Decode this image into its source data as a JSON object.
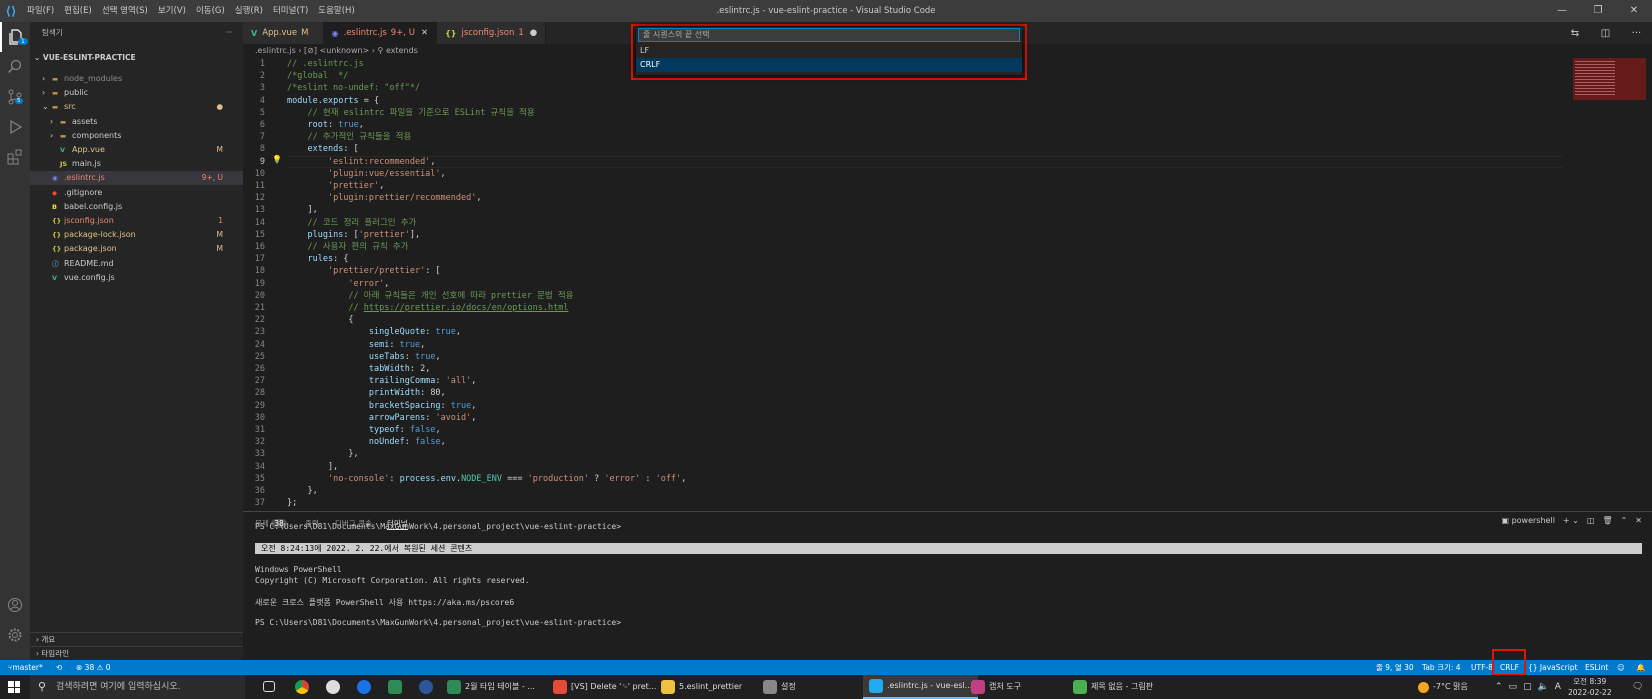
{
  "window": {
    "title": ".eslintrc.js - vue-eslint-practice - Visual Studio Code",
    "menus": [
      "파일(F)",
      "편집(E)",
      "선택 영역(S)",
      "보기(V)",
      "이동(G)",
      "실행(R)",
      "터미널(T)",
      "도움말(H)"
    ],
    "controls": [
      "—",
      "❐",
      "✕"
    ]
  },
  "activity": {
    "badge": "1"
  },
  "sidebar": {
    "header": "탐색기",
    "header_more": "···",
    "project": "VUE-ESLINT-PRACTICE",
    "items": [
      {
        "label": "node_modules",
        "status": "",
        "kind": "folder",
        "depth": 1,
        "arrow": "›",
        "color": "#8c8c8c"
      },
      {
        "label": "public",
        "status": "",
        "kind": "folder",
        "depth": 1,
        "arrow": "›",
        "color": "#cccccc"
      },
      {
        "label": "src",
        "status": "●",
        "kind": "folder",
        "depth": 1,
        "arrow": "⌄",
        "color": "#e2c08d"
      },
      {
        "label": "assets",
        "status": "",
        "kind": "folder",
        "depth": 2,
        "arrow": "›",
        "color": "#cccccc"
      },
      {
        "label": "components",
        "status": "",
        "kind": "folder",
        "depth": 2,
        "arrow": "›",
        "color": "#cccccc"
      },
      {
        "label": "App.vue",
        "status": "M",
        "kind": "vue",
        "depth": 2,
        "arrow": "",
        "color": "#e2c08d"
      },
      {
        "label": "main.js",
        "status": "",
        "kind": "js",
        "depth": 2,
        "arrow": "",
        "color": "#cccccc"
      },
      {
        "label": ".eslintrc.js",
        "status": "9+, U",
        "kind": "eslint",
        "depth": 1,
        "arrow": "",
        "color": "#f48771"
      },
      {
        "label": ".gitignore",
        "status": "",
        "kind": "git",
        "depth": 1,
        "arrow": "",
        "color": "#cccccc"
      },
      {
        "label": "babel.config.js",
        "status": "",
        "kind": "babel",
        "depth": 1,
        "arrow": "",
        "color": "#cccccc"
      },
      {
        "label": "jsconfig.json",
        "status": "1",
        "kind": "json",
        "depth": 1,
        "arrow": "",
        "color": "#f48771"
      },
      {
        "label": "package-lock.json",
        "status": "M",
        "kind": "json",
        "depth": 1,
        "arrow": "",
        "color": "#e2c08d"
      },
      {
        "label": "package.json",
        "status": "M",
        "kind": "json",
        "depth": 1,
        "arrow": "",
        "color": "#e2c08d"
      },
      {
        "label": "README.md",
        "status": "",
        "kind": "md",
        "depth": 1,
        "arrow": "",
        "color": "#cccccc"
      },
      {
        "label": "vue.config.js",
        "status": "",
        "kind": "vuejs",
        "depth": 1,
        "arrow": "",
        "color": "#cccccc"
      }
    ],
    "outline": "개요",
    "timeline": "타임라인"
  },
  "tabs": [
    {
      "label": "App.vue",
      "status": "M",
      "color": "#e2c08d",
      "icon": "V",
      "icon_color": "#41b883"
    },
    {
      "label": ".eslintrc.js",
      "status": "9+, U",
      "color": "#f48771",
      "icon": "◉",
      "icon_color": "#8080f2"
    },
    {
      "label": "jsconfig.json",
      "status": "1",
      "color": "#f48771",
      "icon": "{}",
      "icon_color": "#cbcb41"
    }
  ],
  "breadcrumb": ".eslintrc.js  ›  [⊘] <unknown>  ›  ⚲ extends",
  "code_lines": [
    [
      [
        "c-com",
        "// .eslintrc.js"
      ]
    ],
    [
      [
        "c-com",
        "/*global  */"
      ]
    ],
    [
      [
        "c-com",
        "/*eslint no-undef: \"off\"*/"
      ]
    ],
    [
      [
        "c-id",
        "module"
      ],
      [
        "",
        "."
      ],
      [
        "c-id",
        "exports"
      ],
      [
        "",
        " = {"
      ]
    ],
    [
      [
        "",
        "    "
      ],
      [
        "c-com",
        "// 현재 eslintrc 파일을 기준으로 ESLint 규칙을 적용"
      ]
    ],
    [
      [
        "",
        "    "
      ],
      [
        "c-prop",
        "root"
      ],
      [
        "",
        ": "
      ],
      [
        "c-kw",
        "true"
      ],
      [
        "",
        ","
      ]
    ],
    [
      [
        "",
        "    "
      ],
      [
        "c-com",
        "// 추가적인 규칙들을 적용"
      ]
    ],
    [
      [
        "",
        "    "
      ],
      [
        "c-prop",
        "extends"
      ],
      [
        "",
        ": ["
      ]
    ],
    [
      [
        "",
        "        "
      ],
      [
        "c-str",
        "'eslint:recommended'"
      ],
      [
        "",
        ","
      ]
    ],
    [
      [
        "",
        "        "
      ],
      [
        "c-str",
        "'plugin:vue/essential'"
      ],
      [
        "",
        ","
      ]
    ],
    [
      [
        "",
        "        "
      ],
      [
        "c-str",
        "'prettier'"
      ],
      [
        "",
        ","
      ]
    ],
    [
      [
        "",
        "        "
      ],
      [
        "c-str",
        "'plugin:prettier/recommended'"
      ],
      [
        "",
        ","
      ]
    ],
    [
      [
        "",
        "    ],"
      ]
    ],
    [
      [
        "",
        "    "
      ],
      [
        "c-com",
        "// 코드 정리 플러그인 추가"
      ]
    ],
    [
      [
        "",
        "    "
      ],
      [
        "c-prop",
        "plugins"
      ],
      [
        "",
        ": ["
      ],
      [
        "c-str",
        "'prettier'"
      ],
      [
        "",
        "],"
      ]
    ],
    [
      [
        "",
        "    "
      ],
      [
        "c-com",
        "// 사용자 편의 규칙 추가"
      ]
    ],
    [
      [
        "",
        "    "
      ],
      [
        "c-prop",
        "rules"
      ],
      [
        "",
        ": {"
      ]
    ],
    [
      [
        "",
        "        "
      ],
      [
        "c-str",
        "'prettier/prettier'"
      ],
      [
        "",
        ": ["
      ]
    ],
    [
      [
        "",
        "            "
      ],
      [
        "c-str",
        "'error'"
      ],
      [
        "",
        ","
      ]
    ],
    [
      [
        "",
        "            "
      ],
      [
        "c-com",
        "// 아래 규칙들은 개인 선호에 따라 prettier 문법 적용"
      ]
    ],
    [
      [
        "",
        "            "
      ],
      [
        "c-com",
        "// "
      ],
      [
        "c-lnk",
        "https://prettier.io/docs/en/options.html"
      ]
    ],
    [
      [
        "",
        "            {"
      ]
    ],
    [
      [
        "",
        "                "
      ],
      [
        "c-prop",
        "singleQuote"
      ],
      [
        "",
        ": "
      ],
      [
        "c-kw",
        "true"
      ],
      [
        "",
        ","
      ]
    ],
    [
      [
        "",
        "                "
      ],
      [
        "c-prop",
        "semi"
      ],
      [
        "",
        ": "
      ],
      [
        "c-kw",
        "true"
      ],
      [
        "",
        ","
      ]
    ],
    [
      [
        "",
        "                "
      ],
      [
        "c-prop",
        "useTabs"
      ],
      [
        "",
        ": "
      ],
      [
        "c-kw",
        "true"
      ],
      [
        "",
        ","
      ]
    ],
    [
      [
        "",
        "                "
      ],
      [
        "c-prop",
        "tabWidth"
      ],
      [
        "",
        ": 2,"
      ]
    ],
    [
      [
        "",
        "                "
      ],
      [
        "c-prop",
        "trailingComma"
      ],
      [
        "",
        ": "
      ],
      [
        "c-str",
        "'all'"
      ],
      [
        "",
        ","
      ]
    ],
    [
      [
        "",
        "                "
      ],
      [
        "c-prop",
        "printWidth"
      ],
      [
        "",
        ": 80,"
      ]
    ],
    [
      [
        "",
        "                "
      ],
      [
        "c-prop",
        "bracketSpacing"
      ],
      [
        "",
        ": "
      ],
      [
        "c-kw",
        "true"
      ],
      [
        "",
        ","
      ]
    ],
    [
      [
        "",
        "                "
      ],
      [
        "c-prop",
        "arrowParens"
      ],
      [
        "",
        ": "
      ],
      [
        "c-str",
        "'avoid'"
      ],
      [
        "",
        ","
      ]
    ],
    [
      [
        "",
        "                "
      ],
      [
        "c-prop",
        "typeof"
      ],
      [
        "",
        ": "
      ],
      [
        "c-kw",
        "false"
      ],
      [
        "",
        ","
      ]
    ],
    [
      [
        "",
        "                "
      ],
      [
        "c-prop",
        "noUndef"
      ],
      [
        "",
        ": "
      ],
      [
        "c-kw",
        "false"
      ],
      [
        "",
        ","
      ]
    ],
    [
      [
        "",
        "            },"
      ]
    ],
    [
      [
        "",
        "        ],"
      ]
    ],
    [
      [
        "",
        "        "
      ],
      [
        "c-str",
        "'no-console'"
      ],
      [
        "",
        ": "
      ],
      [
        "c-id",
        "process"
      ],
      [
        "",
        "."
      ],
      [
        "c-id",
        "env"
      ],
      [
        "",
        "."
      ],
      [
        "c-cls",
        "NODE_ENV"
      ],
      [
        "",
        " === "
      ],
      [
        "c-str",
        "'production'"
      ],
      [
        "",
        " ? "
      ],
      [
        "c-str",
        "'error'"
      ],
      [
        "",
        " : "
      ],
      [
        "c-str",
        "'off'"
      ],
      [
        "",
        ","
      ]
    ],
    [
      [
        "",
        "    },"
      ]
    ],
    [
      [
        "",
        "};"
      ]
    ]
  ],
  "quickpick": {
    "placeholder": "줄 시퀀스의 끝 선택",
    "options": [
      "LF",
      "CRLF"
    ],
    "selected": "CRLF"
  },
  "panel": {
    "tabs": [
      "문제",
      "출력",
      "디버그 콘솔",
      "터미널"
    ],
    "problems_count": "38",
    "shell": "powershell",
    "terminal_lines": [
      "PS C:\\Users\\D81\\Documents\\MaxGunWork\\4.personal_project\\vue-eslint-practice>",
      "오전 8:24:13에 2022. 2. 22.에서 복원된 세션 콘텐츠",
      "Windows PowerShell",
      "Copyright (C) Microsoft Corporation. All rights reserved.",
      "새로운 크로스 플랫폼 PowerShell 사용 https://aka.ms/pscore6",
      "PS C:\\Users\\D81\\Documents\\MaxGunWork\\4.personal_project\\vue-eslint-practice>"
    ]
  },
  "statusbar": {
    "branch": "master*",
    "sync": "⟲",
    "errors": "⊗ 38 ⚠ 0",
    "position": "줄 9, 열 30",
    "tab_size": "Tab 크기: 4",
    "encoding": "UTF-8",
    "eol": "CRLF",
    "language": "{} JavaScript",
    "linter": "ESLint"
  },
  "taskbar": {
    "search_placeholder": "검색하려면 여기에 입력하십시오.",
    "apps": [
      {
        "label": "2월 타임 테이블 - ...",
        "color": "#2e8b57"
      },
      {
        "label": "[VS] Delete '␍' pret...",
        "color": "#e04e39"
      },
      {
        "label": "5.eslint_prettier",
        "color": "#f0c040"
      },
      {
        "label": "설정",
        "color": "#888888"
      },
      {
        "label": ".eslintrc.js - vue-esl...",
        "color": "#23a9f2"
      },
      {
        "label": "캡처 도구",
        "color": "#c04080"
      },
      {
        "label": "제목 없음 - 그림판",
        "color": "#4caf50"
      }
    ],
    "weather": "-7°C 맑음",
    "ime": "A",
    "time": "오전 8:39",
    "date": "2022-02-22"
  }
}
